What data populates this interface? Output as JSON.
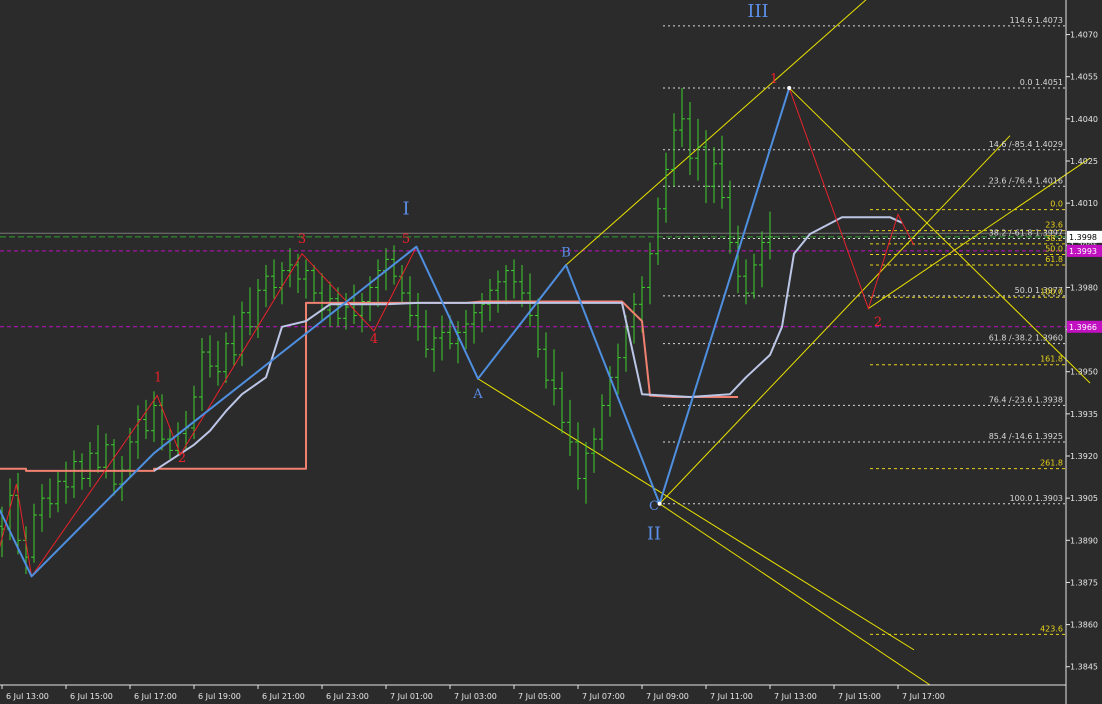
{
  "chart_data": {
    "type": "bar",
    "ylim": [
      1.38385,
      1.40823
    ],
    "y_ticks": [
      "1.4070",
      "1.4055",
      "1.4040",
      "1.4025",
      "1.4010",
      "1.3995",
      "1.3980",
      "1.3965",
      "1.3950",
      "1.3935",
      "1.3920",
      "1.3905",
      "1.3890",
      "1.3875",
      "1.3860",
      "1.3845"
    ],
    "x_ticks": [
      {
        "label": "6 Jul 13:00",
        "i": 0
      },
      {
        "label": "6 Jul 15:00",
        "i": 8
      },
      {
        "label": "6 Jul 17:00",
        "i": 16
      },
      {
        "label": "6 Jul 19:00",
        "i": 24
      },
      {
        "label": "6 Jul 21:00",
        "i": 32
      },
      {
        "label": "6 Jul 23:00",
        "i": 40
      },
      {
        "label": "7 Jul 01:00",
        "i": 48
      },
      {
        "label": "7 Jul 03:00",
        "i": 56
      },
      {
        "label": "7 Jul 05:00",
        "i": 64
      },
      {
        "label": "7 Jul 07:00",
        "i": 72
      },
      {
        "label": "7 Jul 09:00",
        "i": 80
      },
      {
        "label": "7 Jul 11:00",
        "i": 88
      },
      {
        "label": "7 Jul 13:00",
        "i": 96
      },
      {
        "label": "7 Jul 15:00",
        "i": 104
      },
      {
        "label": "7 Jul 17:00",
        "i": 112
      }
    ],
    "price_labels": [
      {
        "value": 1.3998,
        "text": "1.3998",
        "bg": "#ffffff",
        "fg": "#000000"
      },
      {
        "value": 1.3993,
        "text": "1.3993",
        "bg": "#c010c0",
        "fg": "#ffffff"
      },
      {
        "value": 1.3966,
        "text": "1.3966",
        "bg": "#c010c0",
        "fg": "#ffffff"
      }
    ],
    "fib_right": [
      {
        "value": 1.40731,
        "text": "114.6  1.4073"
      },
      {
        "value": 1.4051,
        "text": "0.0  1.4051"
      },
      {
        "value": 1.4029,
        "text": "14.6 /-85.4  1.4029"
      },
      {
        "value": 1.4016,
        "text": "23.6 /-76.4  1.4016"
      },
      {
        "value": 1.39974,
        "text": "38.2 /-61.8  1.3997"
      },
      {
        "value": 1.3977,
        "text": "50.0  1.3977"
      },
      {
        "value": 1.396,
        "text": "61.8 /-38.2  1.3960"
      },
      {
        "value": 1.3938,
        "text": "76.4 /-23.6  1.3938"
      },
      {
        "value": 1.3925,
        "text": "85.4 /-14.6  1.3925"
      },
      {
        "value": 1.3903,
        "text": "100.0  1.3903"
      }
    ],
    "fib_yellow": [
      {
        "value": 1.40077,
        "text": "0.0"
      },
      {
        "value": 1.40002,
        "text": "23.6"
      },
      {
        "value": 1.39955,
        "text": "38.2"
      },
      {
        "value": 1.39917,
        "text": "50.0"
      },
      {
        "value": 1.3988,
        "text": "61.8"
      },
      {
        "value": 1.39765,
        "text": "100.0"
      },
      {
        "value": 1.39525,
        "text": "161.8"
      },
      {
        "value": 1.39155,
        "text": "261.8"
      },
      {
        "value": 1.38565,
        "text": "423.6"
      }
    ],
    "wave_labels": [
      {
        "text": "I",
        "i": 50.5,
        "value": 1.40059,
        "color": "#5b8fe8",
        "size": 18
      },
      {
        "text": "II",
        "i": 81.5,
        "value": 1.38902,
        "color": "#5b8fe8",
        "size": 18
      },
      {
        "text": "III",
        "i": 94.5,
        "value": 1.40763,
        "color": "#5b8fe8",
        "size": 18
      },
      {
        "text": "A",
        "i": 59.5,
        "value": 1.39407,
        "color": "#5b8fe8",
        "size": 13
      },
      {
        "text": "B",
        "i": 70.5,
        "value": 1.3991,
        "color": "#5b8fe8",
        "size": 13
      },
      {
        "text": "C",
        "i": 81.5,
        "value": 1.39007,
        "color": "#5b8fe8",
        "size": 13
      },
      {
        "text": "1",
        "i": 19.5,
        "value": 1.39465,
        "color": "#e8222a",
        "size": 13
      },
      {
        "text": "2",
        "i": 22.5,
        "value": 1.39178,
        "color": "#e8222a",
        "size": 13
      },
      {
        "text": "3",
        "i": 37.5,
        "value": 1.39959,
        "color": "#e8222a",
        "size": 13
      },
      {
        "text": "4",
        "i": 46.5,
        "value": 1.39602,
        "color": "#e8222a",
        "size": 13
      },
      {
        "text": "5",
        "i": 50.5,
        "value": 1.39959,
        "color": "#e8222a",
        "size": 13
      },
      {
        "text": "1",
        "i": 96.5,
        "value": 1.40528,
        "color": "#e8222a",
        "size": 13
      },
      {
        "text": "2",
        "i": 109.5,
        "value": 1.39663,
        "color": "#e8222a",
        "size": 13
      }
    ],
    "ohlc": [
      [
        1.3895,
        1.3902,
        1.3884,
        1.3894
      ],
      [
        1.3894,
        1.3912,
        1.389,
        1.3906
      ],
      [
        1.3906,
        1.3914,
        1.3885,
        1.389
      ],
      [
        1.389,
        1.3895,
        1.3878,
        1.3884
      ],
      [
        1.3884,
        1.3903,
        1.3882,
        1.3899
      ],
      [
        1.3899,
        1.391,
        1.3893,
        1.3905
      ],
      [
        1.3905,
        1.3912,
        1.3898,
        1.3903
      ],
      [
        1.3903,
        1.3915,
        1.39,
        1.3911
      ],
      [
        1.3911,
        1.3918,
        1.3903,
        1.3909
      ],
      [
        1.3909,
        1.3922,
        1.3905,
        1.3918
      ],
      [
        1.3918,
        1.3921,
        1.3908,
        1.3912
      ],
      [
        1.3912,
        1.3925,
        1.3909,
        1.3921
      ],
      [
        1.3921,
        1.3931,
        1.3914,
        1.3916
      ],
      [
        1.3916,
        1.3928,
        1.3912,
        1.3924
      ],
      [
        1.3924,
        1.3926,
        1.3906,
        1.391
      ],
      [
        1.391,
        1.392,
        1.3904,
        1.3915
      ],
      [
        1.3915,
        1.393,
        1.3912,
        1.3925
      ],
      [
        1.3925,
        1.3938,
        1.3919,
        1.3933
      ],
      [
        1.3933,
        1.394,
        1.3926,
        1.3929
      ],
      [
        1.3929,
        1.3943,
        1.3925,
        1.3938
      ],
      [
        1.3938,
        1.3942,
        1.3922,
        1.3926
      ],
      [
        1.3926,
        1.393,
        1.3919,
        1.3922
      ],
      [
        1.3922,
        1.3932,
        1.392,
        1.3928
      ],
      [
        1.3928,
        1.3936,
        1.3922,
        1.393
      ],
      [
        1.393,
        1.3945,
        1.3926,
        1.3941
      ],
      [
        1.3941,
        1.3962,
        1.3936,
        1.3957
      ],
      [
        1.3957,
        1.3963,
        1.3948,
        1.3952
      ],
      [
        1.3952,
        1.3961,
        1.3945,
        1.395
      ],
      [
        1.395,
        1.3964,
        1.3946,
        1.396
      ],
      [
        1.396,
        1.397,
        1.3952,
        1.3956
      ],
      [
        1.3956,
        1.3975,
        1.3952,
        1.3971
      ],
      [
        1.3971,
        1.398,
        1.3963,
        1.3966
      ],
      [
        1.3966,
        1.3983,
        1.3962,
        1.3979
      ],
      [
        1.3979,
        1.3988,
        1.3973,
        1.3984
      ],
      [
        1.3984,
        1.399,
        1.3976,
        1.398
      ],
      [
        1.398,
        1.3989,
        1.3974,
        1.3986
      ],
      [
        1.3986,
        1.3994,
        1.398,
        1.3988
      ],
      [
        1.3988,
        1.3992,
        1.3978,
        1.3983
      ],
      [
        1.3983,
        1.399,
        1.3976,
        1.3986
      ],
      [
        1.3986,
        1.3988,
        1.3975,
        1.3978
      ],
      [
        1.3978,
        1.3985,
        1.3968,
        1.3972
      ],
      [
        1.3972,
        1.3982,
        1.3966,
        1.3976
      ],
      [
        1.3976,
        1.398,
        1.3966,
        1.3969
      ],
      [
        1.3969,
        1.3978,
        1.3965,
        1.3973
      ],
      [
        1.3973,
        1.3981,
        1.3967,
        1.397
      ],
      [
        1.397,
        1.3978,
        1.3964,
        1.3975
      ],
      [
        1.3975,
        1.3984,
        1.3968,
        1.398
      ],
      [
        1.398,
        1.399,
        1.3973,
        1.3986
      ],
      [
        1.3986,
        1.3994,
        1.3979,
        1.399
      ],
      [
        1.399,
        1.3995,
        1.3981,
        1.3984
      ],
      [
        1.3984,
        1.3988,
        1.3974,
        1.3978
      ],
      [
        1.3978,
        1.3984,
        1.3966,
        1.397
      ],
      [
        1.397,
        1.3978,
        1.3961,
        1.3966
      ],
      [
        1.3966,
        1.3972,
        1.3955,
        1.3958
      ],
      [
        1.3958,
        1.3966,
        1.395,
        1.3962
      ],
      [
        1.3962,
        1.397,
        1.3954,
        1.3964
      ],
      [
        1.3964,
        1.397,
        1.3958,
        1.396
      ],
      [
        1.396,
        1.3968,
        1.3953,
        1.3964
      ],
      [
        1.3964,
        1.3972,
        1.3958,
        1.3967
      ],
      [
        1.3967,
        1.3975,
        1.396,
        1.3971
      ],
      [
        1.3971,
        1.3978,
        1.3964,
        1.3974
      ],
      [
        1.3974,
        1.3983,
        1.3968,
        1.3979
      ],
      [
        1.3979,
        1.3986,
        1.3971,
        1.3982
      ],
      [
        1.3982,
        1.3988,
        1.3974,
        1.3986
      ],
      [
        1.3986,
        1.399,
        1.3976,
        1.3982
      ],
      [
        1.3982,
        1.3988,
        1.3973,
        1.3978
      ],
      [
        1.3978,
        1.3985,
        1.3966,
        1.397
      ],
      [
        1.397,
        1.3976,
        1.3955,
        1.3958
      ],
      [
        1.3958,
        1.3964,
        1.3944,
        1.3947
      ],
      [
        1.3947,
        1.3958,
        1.3938,
        1.3944
      ],
      [
        1.3944,
        1.395,
        1.3928,
        1.3932
      ],
      [
        1.3932,
        1.394,
        1.392,
        1.3925
      ],
      [
        1.3925,
        1.3932,
        1.3908,
        1.3912
      ],
      [
        1.3912,
        1.3925,
        1.3903,
        1.3921
      ],
      [
        1.3921,
        1.393,
        1.3914,
        1.3926
      ],
      [
        1.3926,
        1.3942,
        1.3922,
        1.3938
      ],
      [
        1.3938,
        1.3952,
        1.3934,
        1.3948
      ],
      [
        1.3948,
        1.396,
        1.3942,
        1.3955
      ],
      [
        1.3955,
        1.397,
        1.395,
        1.3966
      ],
      [
        1.3966,
        1.3978,
        1.396,
        1.3974
      ],
      [
        1.3974,
        1.3984,
        1.3964,
        1.398
      ],
      [
        1.398,
        1.3996,
        1.3974,
        1.3992
      ],
      [
        1.3992,
        1.4012,
        1.3988,
        1.4008
      ],
      [
        1.4008,
        1.4028,
        1.4003,
        1.4022
      ],
      [
        1.4022,
        1.4042,
        1.4016,
        1.4036
      ],
      [
        1.4036,
        1.4051,
        1.403,
        1.404
      ],
      [
        1.404,
        1.4046,
        1.402,
        1.4026
      ],
      [
        1.4026,
        1.404,
        1.4018,
        1.403
      ],
      [
        1.403,
        1.4036,
        1.401,
        1.4016
      ],
      [
        1.4016,
        1.403,
        1.401,
        1.4024
      ],
      [
        1.4024,
        1.4034,
        1.4008,
        1.4012
      ],
      [
        1.4012,
        1.4018,
        1.3992,
        1.3996
      ],
      [
        1.3996,
        1.4002,
        1.3978,
        1.3984
      ],
      [
        1.3984,
        1.399,
        1.3974,
        1.3978
      ],
      [
        1.3978,
        1.3992,
        1.3976,
        1.3988
      ],
      [
        1.3988,
        1.4,
        1.398,
        1.3996
      ],
      [
        1.3996,
        1.4007,
        1.399,
        1.3998
      ]
    ]
  }
}
